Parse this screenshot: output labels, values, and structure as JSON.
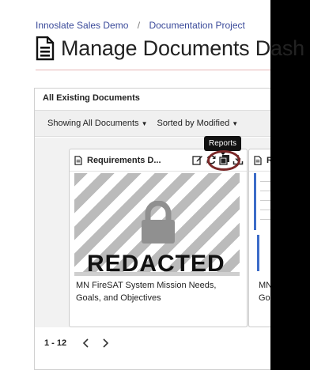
{
  "breadcrumb": {
    "items": [
      "Innoslate Sales Demo",
      "Documentation Project"
    ],
    "separator": "/"
  },
  "page": {
    "title": "Manage Documents Dash"
  },
  "panel": {
    "title": "All Existing Documents",
    "filters": {
      "show_label": "Showing All Documents",
      "sort_label": "Sorted by Modified"
    }
  },
  "cards": [
    {
      "title": "Requirements D...",
      "thumbnail_label": "REDACTED",
      "description": "MN FireSAT System Mission Needs, Goals, and Objectives"
    },
    {
      "title": "R",
      "description_line1": "MN",
      "description_line2": "Goa"
    }
  ],
  "tooltip": {
    "text": "Reports"
  },
  "pagination": {
    "range": "1 - 12"
  },
  "colors": {
    "breadcrumb_link": "#3a4a9a",
    "highlight_ring": "#7a2828",
    "accent_blue": "#3c6cc8"
  }
}
